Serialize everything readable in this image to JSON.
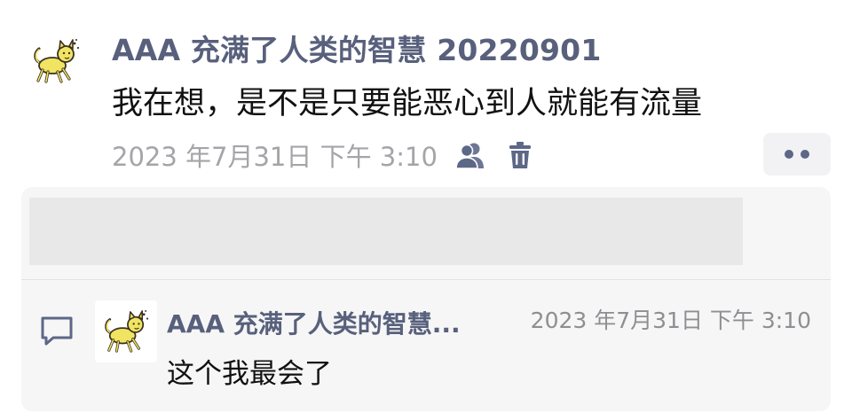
{
  "post": {
    "author": "AAA 充满了人类的智慧 20220901",
    "text": "我在想，是不是只要能恶心到人就能有流量",
    "timestamp": "2023 年7月31日 下午 3:10",
    "icons": {
      "avatar": "yellow-cat-avatar",
      "visibility": "people-icon",
      "delete": "trash-icon",
      "more": "more-dots-icon"
    }
  },
  "comment": {
    "author": "AAA 充满了人类的智慧...",
    "timestamp": "2023 年7月31日 下午 3:10",
    "text": "这个我最会了",
    "icons": {
      "comment": "comment-bubble-icon",
      "avatar": "yellow-cat-avatar"
    }
  },
  "colors": {
    "author_name": "#58607c",
    "timestamp": "#a5a5a9",
    "icon": "#5d6787",
    "panel_background": "#f6f6f6",
    "likes_placeholder": "#e8e8e8"
  }
}
